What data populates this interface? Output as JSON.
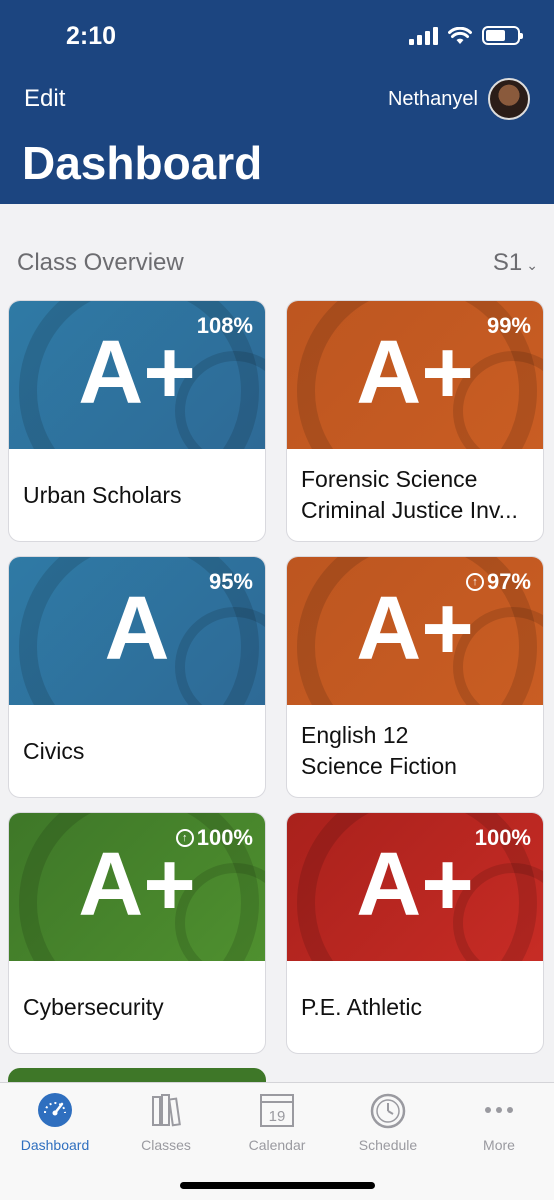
{
  "status": {
    "time": "2:10"
  },
  "header": {
    "edit_label": "Edit",
    "user_name": "Nethanyel",
    "title": "Dashboard"
  },
  "section": {
    "title": "Class Overview",
    "term": "S1"
  },
  "classes": [
    {
      "grade": "A+",
      "percent": "108%",
      "trend_up": false,
      "name_lines": [
        "Urban Scholars"
      ],
      "theme": "blue"
    },
    {
      "grade": "A+",
      "percent": "99%",
      "trend_up": false,
      "name_lines": [
        "Forensic Science",
        "Criminal Justice Inv..."
      ],
      "theme": "orange"
    },
    {
      "grade": "A",
      "percent": "95%",
      "trend_up": false,
      "name_lines": [
        "Civics"
      ],
      "theme": "blue"
    },
    {
      "grade": "A+",
      "percent": "97%",
      "trend_up": true,
      "name_lines": [
        "English 12",
        "Science Fiction"
      ],
      "theme": "orange"
    },
    {
      "grade": "A+",
      "percent": "100%",
      "trend_up": true,
      "name_lines": [
        "Cybersecurity"
      ],
      "theme": "green"
    },
    {
      "grade": "A+",
      "percent": "100%",
      "trend_up": false,
      "name_lines": [
        "P.E. Athletic"
      ],
      "theme": "red"
    }
  ],
  "tabs": [
    {
      "label": "Dashboard",
      "icon": "gauge-icon",
      "active": true
    },
    {
      "label": "Classes",
      "icon": "books-icon",
      "active": false
    },
    {
      "label": "Calendar",
      "icon": "calendar-icon",
      "active": false,
      "calendar_day": "19"
    },
    {
      "label": "Schedule",
      "icon": "clock-icon",
      "active": false
    },
    {
      "label": "More",
      "icon": "more-icon",
      "active": false
    }
  ],
  "colors": {
    "header": "#1c4580",
    "accent": "#2f6fbf",
    "blue": "#2f7aa5",
    "orange": "#c95d23",
    "green": "#4f902f",
    "red": "#c72c25"
  }
}
